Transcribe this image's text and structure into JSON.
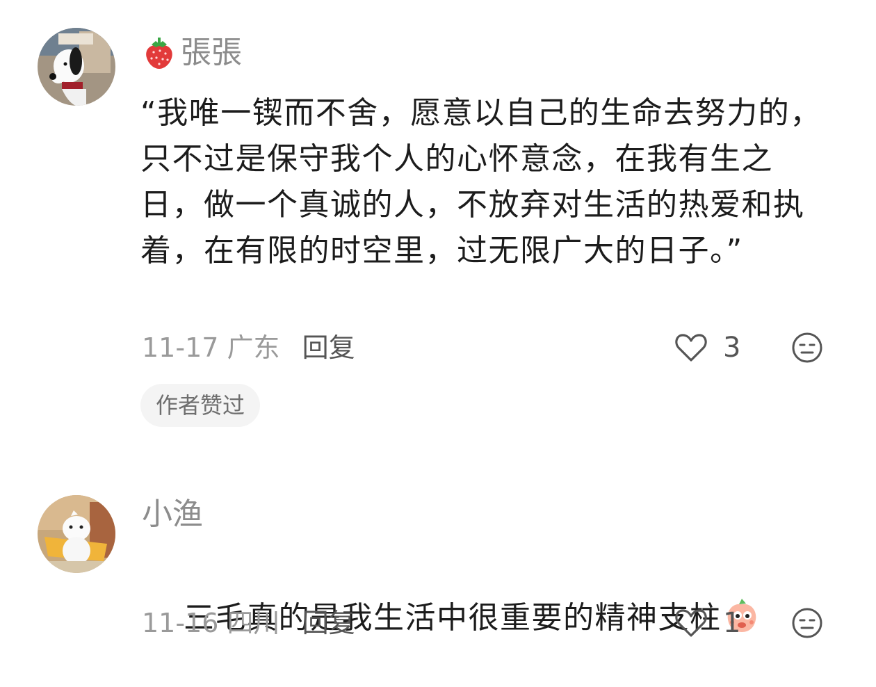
{
  "comments": [
    {
      "username": "張張",
      "badge_icon": "strawberry-icon",
      "text": "“我唯一锲而不舍，愿意以自己的生命去努力的，只不过是保守我个人的心怀意念，在我有生之日，做一个真诚的人，不放弃对生活的热爱和执着，在有限的时空里，过无限广大的日子。”",
      "date_location": "11-17 广东",
      "reply_label": "回复",
      "like_count": "3",
      "author_liked_label": "作者赞过"
    },
    {
      "username": "小渔",
      "text": "三毛真的是我生活中很重要的精神支柱",
      "trailing_emoji": "peach-emoji-icon",
      "date_location": "11-16 四川",
      "reply_label": "回复",
      "like_count": "1"
    }
  ],
  "colors": {
    "username": "#8c8c8c",
    "meta": "#9a9a9a",
    "author_tag_bg": "#f4f4f4"
  }
}
